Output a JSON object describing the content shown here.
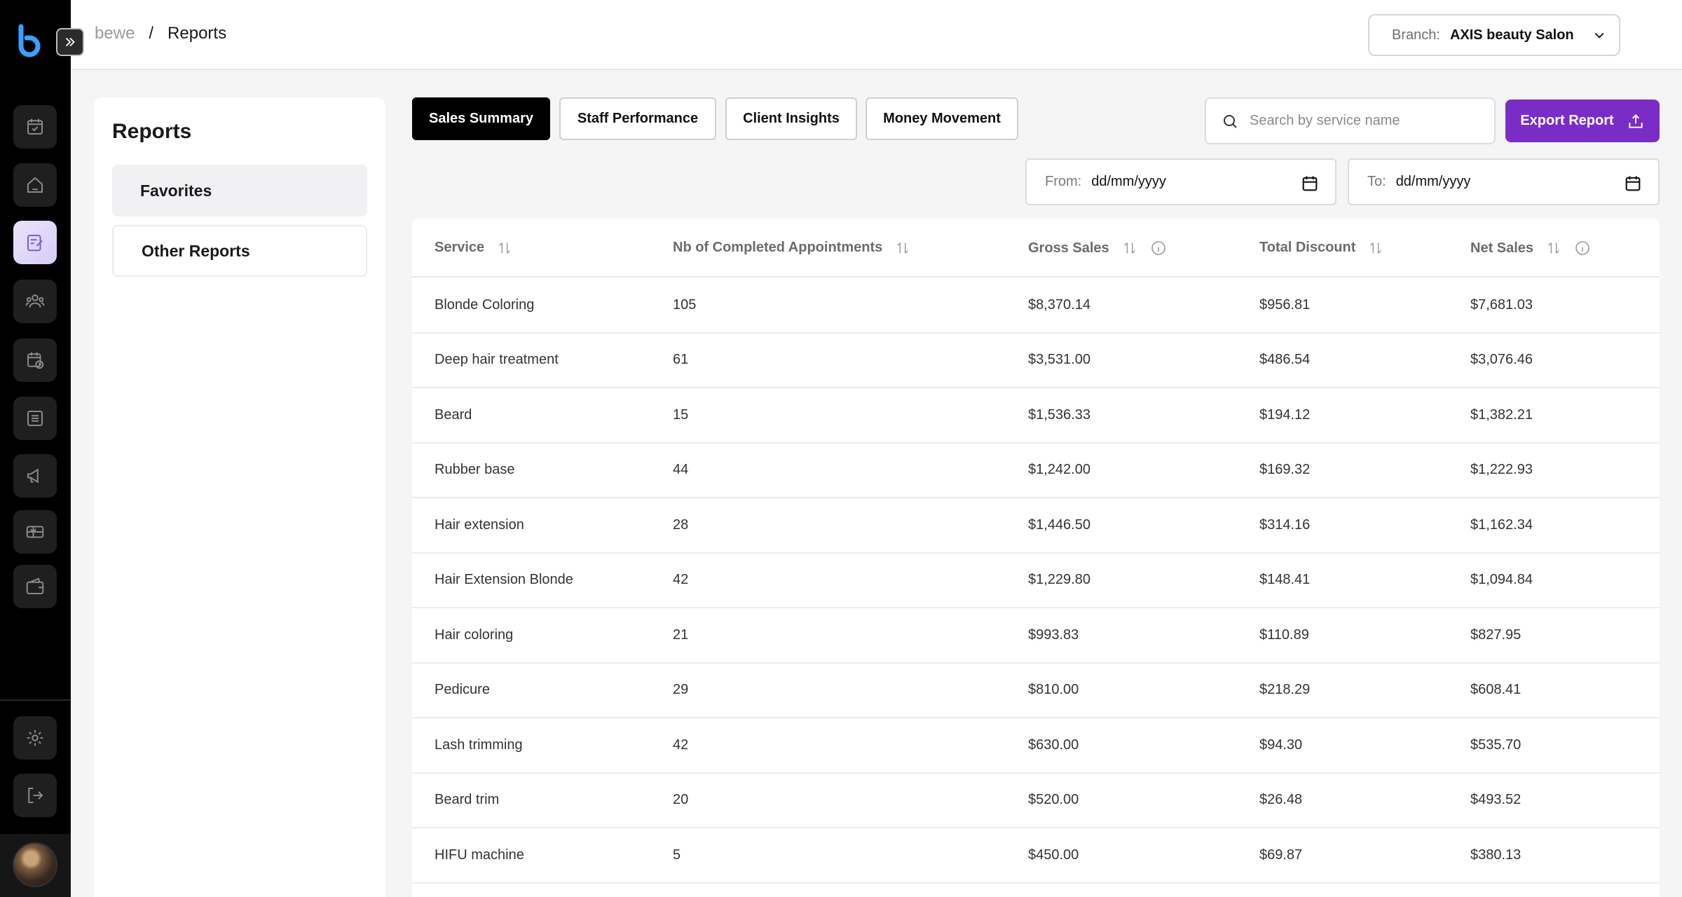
{
  "breadcrumb": {
    "root": "bewe",
    "separator": "/",
    "current": "Reports"
  },
  "branch": {
    "label": "Branch:",
    "value": "AXIS beauty Salon"
  },
  "panel": {
    "title": "Reports",
    "items": [
      {
        "label": "Favorites"
      },
      {
        "label": "Other Reports"
      }
    ]
  },
  "tabs": [
    {
      "label": "Sales Summary",
      "active": true
    },
    {
      "label": "Staff Performance"
    },
    {
      "label": "Client Insights"
    },
    {
      "label": "Money Movement"
    }
  ],
  "search": {
    "placeholder": "Search by service name"
  },
  "export": {
    "label": "Export Report"
  },
  "dates": {
    "from": {
      "label": "From:",
      "value": "dd/mm/yyyy"
    },
    "to": {
      "label": "To:",
      "value": "dd/mm/yyyy"
    }
  },
  "table": {
    "headers": [
      "Service",
      "Nb of Completed Appointments",
      "Gross Sales",
      "Total Discount",
      "Net Sales"
    ],
    "rows": [
      [
        "Blonde Coloring",
        "105",
        "$8,370.14",
        "$956.81",
        "$7,681.03"
      ],
      [
        "Deep hair treatment",
        "61",
        "$3,531.00",
        "$486.54",
        "$3,076.46"
      ],
      [
        "Beard",
        "15",
        "$1,536.33",
        "$194.12",
        "$1,382.21"
      ],
      [
        "Rubber base",
        "44",
        "$1,242.00",
        "$169.32",
        "$1,222.93"
      ],
      [
        "Hair extension",
        "28",
        "$1,446.50",
        "$314.16",
        "$1,162.34"
      ],
      [
        "Hair Extension Blonde",
        "42",
        "$1,229.80",
        "$148.41",
        "$1,094.84"
      ],
      [
        "Hair coloring",
        "21",
        "$993.83",
        "$110.89",
        "$827.95"
      ],
      [
        "Pedicure",
        "29",
        "$810.00",
        "$218.29",
        "$608.41"
      ],
      [
        "Lash trimming",
        "42",
        "$630.00",
        "$94.30",
        "$535.70"
      ],
      [
        "Beard trim",
        "20",
        "$520.00",
        "$26.48",
        "$493.52"
      ],
      [
        "HIFU machine",
        "5",
        "$450.00",
        "$69.87",
        "$380.13"
      ]
    ]
  },
  "colors": {
    "accent": "#7a2cc7",
    "rail": "#000000"
  },
  "rail_icons": [
    "calendar-check-icon",
    "home-icon",
    "reports-icon",
    "clients-icon",
    "schedule-icon",
    "list-icon",
    "megaphone-icon",
    "gift-card-icon",
    "wallet-icon",
    "settings-icon",
    "logout-icon"
  ]
}
